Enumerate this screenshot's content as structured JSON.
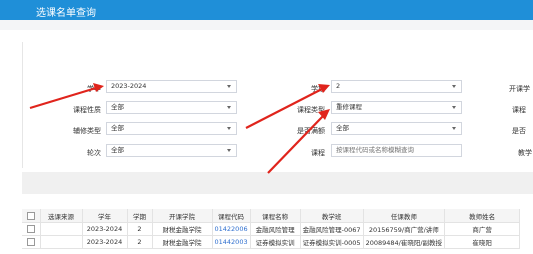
{
  "window": {
    "title": "选课名单查询"
  },
  "filters": {
    "xuenian": {
      "label": "学年",
      "value": "2023-2024"
    },
    "kecheng_xingzhi": {
      "label": "课程性质",
      "value": "全部"
    },
    "fuxiu_leixing": {
      "label": "辅修类型",
      "value": "全部"
    },
    "lunci": {
      "label": "轮次",
      "value": "全部"
    },
    "xueqi": {
      "label": "学期",
      "value": "2"
    },
    "kecheng_leixing": {
      "label": "课程类型",
      "value": "重修课程"
    },
    "shifou_fengding": {
      "label": "是否满额",
      "value": "全部"
    },
    "kecheng": {
      "label": "课程",
      "placeholder": "按课程代码或名称模糊查询"
    },
    "right_cut": [
      "开课学",
      "课程",
      "是否",
      "教学"
    ]
  },
  "table": {
    "headers": [
      "",
      "选课来源",
      "学年",
      "学期",
      "开课学院",
      "课程代码",
      "课程名称",
      "教学班",
      "任课教师",
      "教师姓名"
    ],
    "rows": [
      [
        "",
        "",
        "2023-2024",
        "2",
        "财税金融学院",
        "01422006",
        "金融风险管理",
        "金融风险管理-0067",
        "20156759/商广营/讲师",
        "商广营"
      ],
      [
        "",
        "",
        "2023-2024",
        "2",
        "财税金融学院",
        "01442003",
        "证券模拟实训",
        "证券模拟实训-0005",
        "20089484/崔晓阳/副教授",
        "崔晓阳"
      ]
    ]
  },
  "colors": {
    "titlebar": "#1f8fd8",
    "annotation_arrow": "#e0241c"
  }
}
